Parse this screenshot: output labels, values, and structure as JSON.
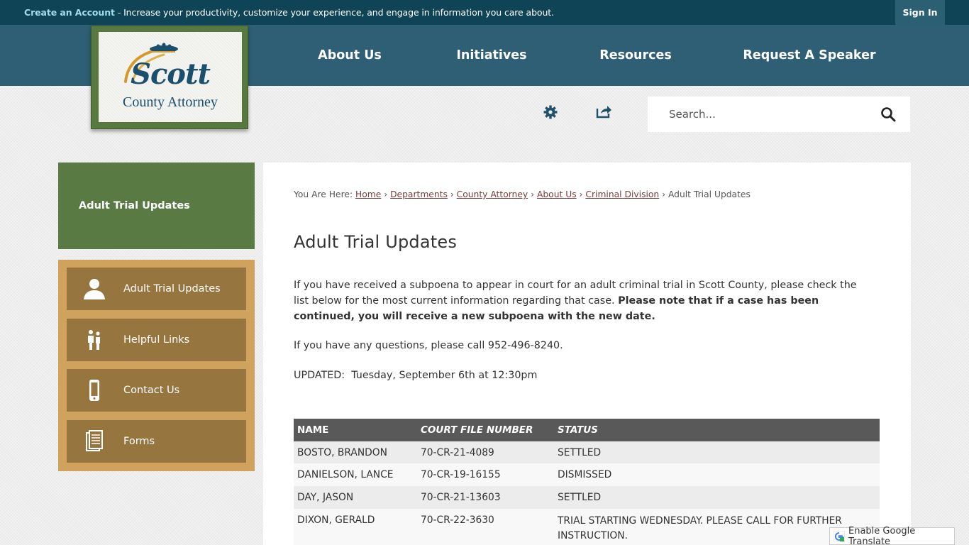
{
  "topbar": {
    "create_label": "Create an Account",
    "message": " - Increase your productivity, customize your experience, and engage in information you care about.",
    "signin_label": "Sign In"
  },
  "logo": {
    "name": "Scott",
    "subtitle": "County Attorney"
  },
  "nav": [
    {
      "label": "About Us"
    },
    {
      "label": "Initiatives"
    },
    {
      "label": "Resources"
    },
    {
      "label": "Request A Speaker"
    }
  ],
  "search": {
    "placeholder": "Search..."
  },
  "sidebar": {
    "title": "Adult Trial Updates",
    "items": [
      {
        "label": "Adult Trial Updates",
        "icon": "person-icon"
      },
      {
        "label": "Helpful Links",
        "icon": "people-icon"
      },
      {
        "label": "Contact Us",
        "icon": "phone-icon"
      },
      {
        "label": "Forms",
        "icon": "document-icon"
      }
    ]
  },
  "breadcrumb": {
    "prefix": "You Are Here: ",
    "links": [
      "Home",
      "Departments",
      "County Attorney",
      "About Us",
      "Criminal Division"
    ],
    "current": "Adult Trial Updates"
  },
  "main": {
    "title": "Adult Trial Updates",
    "intro": "If you have received a subpoena to appear in court for an adult criminal trial in Scott County, please check the list below for the most current information regarding that case. ",
    "intro_bold": "Please note that if a case has been continued, you will receive a new subpoena with the new date.",
    "questions": "If you have any questions, please call 952-496-8240.",
    "updated": "UPDATED:  Tuesday, September 6th at 12:30pm"
  },
  "table": {
    "headers": [
      "NAME",
      "COURT FILE NUMBER",
      "STATUS"
    ],
    "rows": [
      {
        "name": "BOSTO, BRANDON",
        "file": "70-CR-21-4089",
        "status": "SETTLED"
      },
      {
        "name": "DANIELSON, LANCE",
        "file": "70-CR-19-16155",
        "status": "DISMISSED"
      },
      {
        "name": "DAY, JASON",
        "file": "70-CR-21-13603",
        "status": "SETTLED"
      },
      {
        "name": "DIXON, GERALD",
        "file": "70-CR-22-3630",
        "status_line1": "TRIAL STARTING WEDNESDAY. PLEASE CALL FOR FURTHER",
        "status_line2": "INSTRUCTION."
      }
    ]
  },
  "translate": {
    "label": "Enable Google Translate"
  },
  "colors": {
    "topbar": "#0e4456",
    "nav": "#2e5f75",
    "sidebar_title": "#5a7a44",
    "sidebar_menu": "#cfa35e",
    "sidebar_button": "#97753f"
  }
}
